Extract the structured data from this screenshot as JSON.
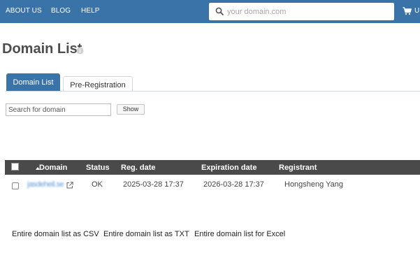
{
  "nav": {
    "items": [
      {
        "label": "ABOUT US"
      },
      {
        "label": "BLOG"
      },
      {
        "label": "HELP"
      }
    ],
    "search": {
      "placeholder": "your domain.com",
      "value": ""
    },
    "cart_label": "U"
  },
  "page": {
    "title": "Domain List"
  },
  "tabs": [
    {
      "label": "Domain List",
      "active": true
    },
    {
      "label": "Pre-Registration",
      "active": false
    }
  ],
  "filter": {
    "placeholder": "Search for domain",
    "value": "",
    "button_label": "Show"
  },
  "table": {
    "columns": [
      "Domain",
      "Status",
      "Reg. date",
      "Expiration date",
      "Registrant"
    ],
    "rows": [
      {
        "domain": "jasdeheil.se",
        "status": "OK",
        "reg_date": "2025-03-28 17:37",
        "expiration_date": "2026-03-28 17:37",
        "registrant": "Hongsheng Yang"
      }
    ]
  },
  "exports": [
    {
      "label": "Entire domain list as CSV"
    },
    {
      "label": "Entire domain list as TXT"
    },
    {
      "label": "Entire domain list for Excel"
    }
  ],
  "colors": {
    "nav_bg": "#3a73a8",
    "active_tab": "#3a73a8",
    "table_header_bg": "#4a4a4a",
    "domain_link": "#5b9bd5"
  }
}
